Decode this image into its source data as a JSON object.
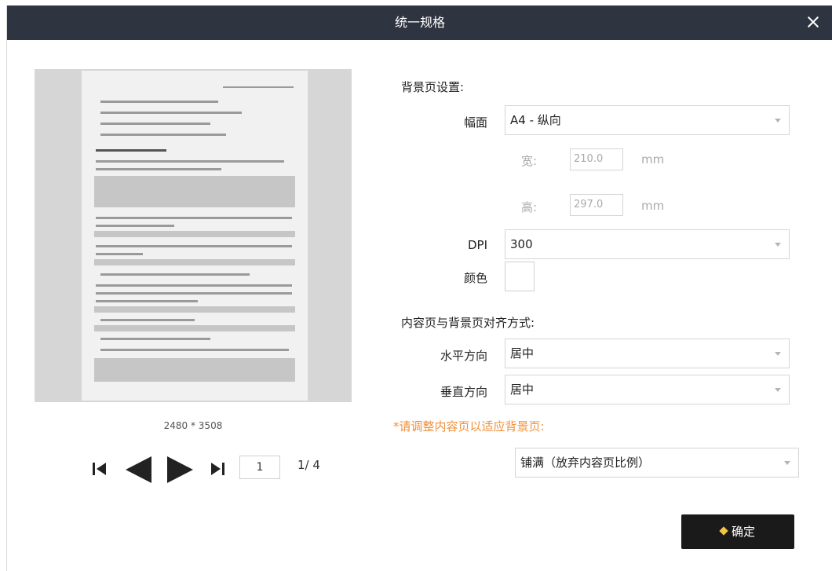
{
  "dialog": {
    "title": "统一规格"
  },
  "preview": {
    "dimensions": "2480 * 3508"
  },
  "pager": {
    "current": "1",
    "count": "1/ 4"
  },
  "background": {
    "section_title": "背景页设置:",
    "size_label": "幅面",
    "size_value": "A4 - 纵向",
    "width_label": "宽:",
    "width_value": "210.0",
    "height_label": "高:",
    "height_value": "297.0",
    "unit": "mm",
    "dpi_label": "DPI",
    "dpi_value": "300",
    "color_label": "颜色"
  },
  "alignment": {
    "section_title": "内容页与背景页对齐方式:",
    "horizontal_label": "水平方向",
    "horizontal_value": "居中",
    "vertical_label": "垂直方向",
    "vertical_value": "居中"
  },
  "fit": {
    "notice": "*请调整内容页以适应背景页:",
    "mode_value": "铺满（放弃内容页比例）"
  },
  "actions": {
    "confirm_label": "确定"
  },
  "colors": {
    "titlebar": "#2f3441",
    "accent_warning": "#f0903a",
    "confirm_bg": "#1a1a1a",
    "confirm_icon": "#f5c542"
  }
}
